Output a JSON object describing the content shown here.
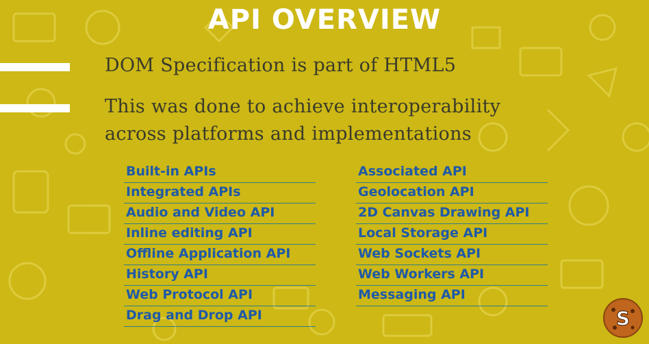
{
  "title": "API OVERVIEW",
  "bullets": [
    "DOM Specification is part of HTML5",
    "This was done to achieve interoperability across platforms and implementations"
  ],
  "apis_left": [
    "Built-in APIs",
    "Integrated APIs",
    "Audio and Video API",
    "Inline editing API",
    "Offline Application API",
    "History API",
    "Web Protocol API",
    "Drag and Drop API"
  ],
  "apis_right": [
    "Associated API",
    "Geolocation API",
    "2D Canvas Drawing API",
    "Local Storage API",
    "Web Sockets API",
    "Web Workers API",
    "Messaging API"
  ],
  "colors": {
    "background": "#cdb815",
    "title": "#ffffff",
    "bullet_text": "#3a3a2a",
    "api_text": "#1f5aa8",
    "underline": "#2f7d88"
  },
  "logo": {
    "letter": "S",
    "icon": "cookie-logo-icon"
  }
}
